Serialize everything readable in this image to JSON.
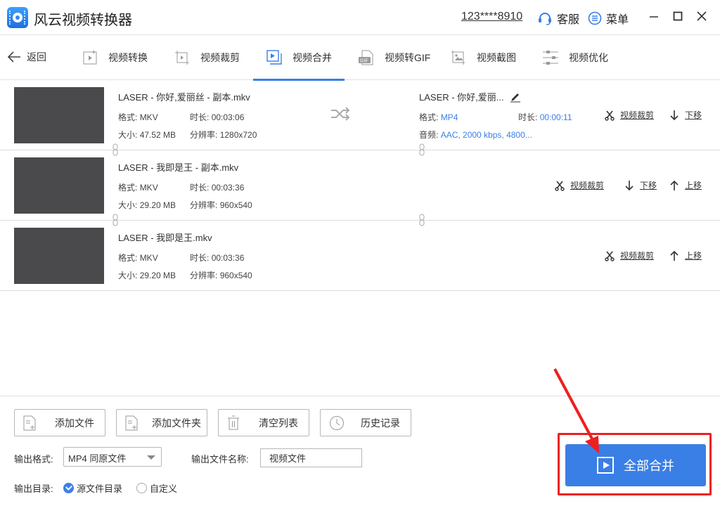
{
  "app": {
    "title": "风云视频转换器",
    "account": "123****8910",
    "service_label": "客服",
    "menu_label": "菜单"
  },
  "nav": {
    "back_label": "返回",
    "tabs": [
      {
        "label": "视频转换",
        "icon": "video-convert-icon",
        "active": false
      },
      {
        "label": "视频裁剪",
        "icon": "video-crop-icon",
        "active": false
      },
      {
        "label": "视频合并",
        "icon": "video-merge-icon",
        "active": true
      },
      {
        "label": "视频转GIF",
        "icon": "gif-icon",
        "active": false
      },
      {
        "label": "视频截图",
        "icon": "image-icon",
        "active": false
      },
      {
        "label": "视频优化",
        "icon": "sliders-icon",
        "active": false
      }
    ]
  },
  "files": [
    {
      "name": "LASER - 你好,爱丽丝 - 副本.mkv",
      "format_label": "格式:",
      "format": "MKV",
      "duration_label": "时长:",
      "duration": "00:03:06",
      "size_label": "大小:",
      "size": "47.52 MB",
      "resolution_label": "分辨率:",
      "resolution": "1280x720",
      "actions": {
        "crop": "视频裁剪",
        "down": "下移"
      }
    },
    {
      "name": "LASER - 我即是王 - 副本.mkv",
      "format_label": "格式:",
      "format": "MKV",
      "duration_label": "时长:",
      "duration": "00:03:36",
      "size_label": "大小:",
      "size": "29.20 MB",
      "resolution_label": "分辨率:",
      "resolution": "960x540",
      "actions": {
        "crop": "视频裁剪",
        "down": "下移",
        "up": "上移"
      }
    },
    {
      "name": "LASER - 我即是王.mkv",
      "format_label": "格式:",
      "format": "MKV",
      "duration_label": "时长:",
      "duration": "00:03:36",
      "size_label": "大小:",
      "size": "29.20 MB",
      "resolution_label": "分辨率:",
      "resolution": "960x540",
      "actions": {
        "crop": "视频裁剪",
        "up": "上移"
      }
    }
  ],
  "output_preview": {
    "name": "LASER - 你好,爱丽...",
    "format_label": "格式:",
    "format": "MP4",
    "duration_label": "时长:",
    "duration": "00:00:11",
    "audio_label": "音频:",
    "audio": "AAC, 2000 kbps, 4800..."
  },
  "bottom": {
    "buttons": {
      "add_file": "添加文件",
      "add_folder": "添加文件夹",
      "clear_list": "清空列表",
      "history": "历史记录"
    },
    "output_format_label": "输出格式:",
    "output_format_value": "MP4 同原文件",
    "output_name_label": "输出文件名称:",
    "output_name_value": "视频文件",
    "output_dir_label": "输出目录:",
    "dir_options": [
      {
        "label": "源文件目录",
        "checked": true
      },
      {
        "label": "自定义",
        "checked": false
      }
    ],
    "merge_all": "全部合并"
  },
  "colors": {
    "accent": "#3a7fe6",
    "annotation": "#ee1f1f"
  }
}
